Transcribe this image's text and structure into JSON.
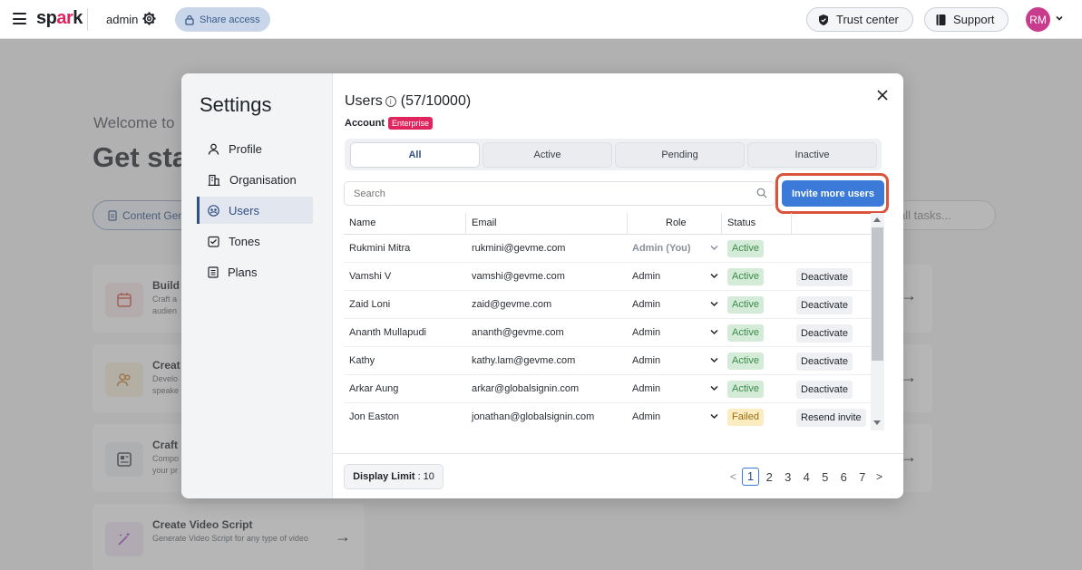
{
  "app": {
    "logo_text_a": "sp",
    "logo_text_b": "ar",
    "logo_text_c": "k",
    "workspace": "admin",
    "share_label": "Share access",
    "trust_label": "Trust center",
    "support_label": "Support",
    "avatar_initials": "RM"
  },
  "background": {
    "welcome": "Welcome to",
    "title": "Get sta",
    "chip_label": "Content Gen",
    "search_placeholder": "all tasks...",
    "cards": [
      {
        "title": "Build",
        "desc": "Craft a\naudien",
        "icon": "calendar-icon",
        "tint": "#fbe9ea"
      },
      {
        "title": "Creat",
        "desc": "Develo\nspeake",
        "icon": "users-icon",
        "tint": "#fbf0dd"
      },
      {
        "title": "Craft",
        "desc": "Compo\nyour pr",
        "icon": "document-icon",
        "tint": "#eef0f3"
      },
      {
        "title": "Create Video Script",
        "desc": "Generate Video Script for any type of video",
        "icon": "magic-wand-icon",
        "tint": "#f3e6f7"
      }
    ]
  },
  "settings": {
    "title": "Settings",
    "nav": [
      {
        "label": "Profile",
        "icon": "person-icon"
      },
      {
        "label": "Organisation",
        "icon": "building-icon"
      },
      {
        "label": "Users",
        "icon": "users-icon"
      },
      {
        "label": "Tones",
        "icon": "tones-icon"
      },
      {
        "label": "Plans",
        "icon": "plans-icon"
      }
    ],
    "active_nav": "Users"
  },
  "users": {
    "title": "Users",
    "count": "(57/10000)",
    "account_label": "Account",
    "account_plan": "Enterprise",
    "tabs": [
      "All",
      "Active",
      "Pending",
      "Inactive"
    ],
    "active_tab": "All",
    "search_placeholder": "Search",
    "invite_label": "Invite more users",
    "columns": {
      "name": "Name",
      "email": "Email",
      "role": "Role",
      "status": "Status"
    },
    "rows": [
      {
        "name": "Rukmini Mitra",
        "email": "rukmini@gevme.com",
        "role": "Admin (You)",
        "status": "Active",
        "action": ""
      },
      {
        "name": "Vamshi V",
        "email": "vamshi@gevme.com",
        "role": "Admin",
        "status": "Active",
        "action": "Deactivate"
      },
      {
        "name": "Zaid Loni",
        "email": "zaid@gevme.com",
        "role": "Admin",
        "status": "Active",
        "action": "Deactivate"
      },
      {
        "name": "Ananth Mullapudi",
        "email": "ananth@gevme.com",
        "role": "Admin",
        "status": "Active",
        "action": "Deactivate"
      },
      {
        "name": "Kathy",
        "email": "kathy.lam@gevme.com",
        "role": "Admin",
        "status": "Active",
        "action": "Deactivate"
      },
      {
        "name": "Arkar Aung",
        "email": "arkar@globalsignin.com",
        "role": "Admin",
        "status": "Active",
        "action": "Deactivate"
      },
      {
        "name": "Jon Easton",
        "email": "jonathan@globalsignin.com",
        "role": "Admin",
        "status": "Failed",
        "action": "Resend invite"
      }
    ],
    "display_limit_label": "Display Limit",
    "display_limit_value": "10",
    "pages": [
      "1",
      "2",
      "3",
      "4",
      "5",
      "6",
      "7"
    ],
    "current_page": "1"
  },
  "colors": {
    "accent": "#3b7ad9",
    "brand_pink": "#e0245e",
    "highlight_ring": "#d9533d"
  }
}
